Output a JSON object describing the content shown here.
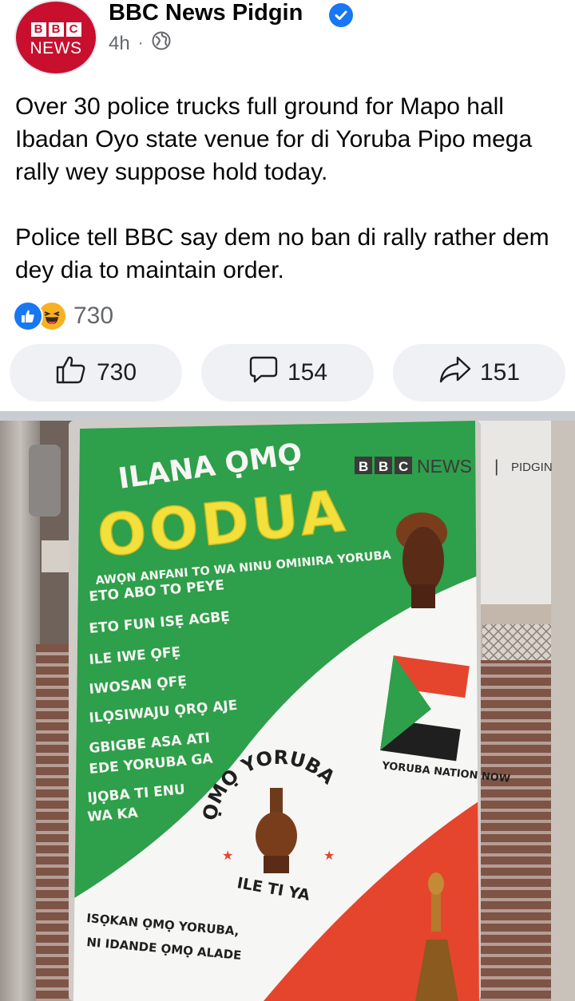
{
  "page": {
    "name": "BBC News Pidgin",
    "avatar_top": "BBC",
    "avatar_bottom": "NEWS",
    "time": "4h",
    "dot": "·",
    "audience_icon": "globe-icon",
    "verified_icon": "verified-badge-icon"
  },
  "post": {
    "text": "Over 30 police trucks full ground for Mapo hall Ibadan Oyo state venue for di Yoruba Pipo mega rally wey suppose hold today.\n\nPolice tell BBC say dem no ban di rally rather dem dey dia to maintain order."
  },
  "reactions": {
    "icons": [
      "like-icon",
      "haha-icon"
    ],
    "count": "730"
  },
  "actions": {
    "like": {
      "icon": "thumbs-up-icon",
      "count": "730"
    },
    "comment": {
      "icon": "comment-icon",
      "count": "154"
    },
    "share": {
      "icon": "share-icon",
      "count": "151"
    }
  },
  "photo": {
    "watermark": {
      "bbc": "BBC",
      "news": "NEWS",
      "divider": "|",
      "section": "PIDGIN"
    },
    "poster": {
      "heading_line1": "ILANA ỌMỌ",
      "heading_line2": "OODUA",
      "subtitle": "AWỌN ANFANI TO WA NINU OMINIRA YORUBA",
      "bullets": [
        "ETO ABO TO PEYE",
        "ETO FUN ISẸ AGBẸ",
        "ILE IWE ỌFẸ",
        "IWOSAN ỌFẸ",
        "ILỌSIWAJU ỌRỌ AJE",
        "GBIGBE ASA ATI",
        "EDE YORUBA GA",
        "IJỌBA TI ENU",
        "WA KA"
      ],
      "flag_caption": "YORUBA NATION NOW",
      "seal_top": "ỌMỌ YORUBA",
      "seal_bottom": "ILE TI YA",
      "footer_line1": "ISỌKAN ỌMỌ YORUBA,",
      "footer_line2": "NI IDANDE ỌMỌ ALADE"
    },
    "colors": {
      "green": "#2e9f4a",
      "white": "#f6f6f4",
      "red": "#e5452d",
      "yellow": "#f3e03b",
      "brick": "#8a5a4b"
    }
  },
  "colors": {
    "accent": "#1877f2",
    "text_secondary": "#65676b",
    "button_bg": "#eff1f4",
    "bbc_red": "#c8102e"
  }
}
